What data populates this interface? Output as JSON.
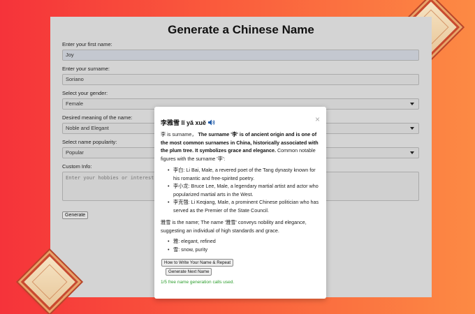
{
  "app": {
    "title": "Generate a Chinese Name",
    "fields": {
      "first_name": {
        "label": "Enter your first name:",
        "value": "Joy"
      },
      "surname": {
        "label": "Enter your surname:",
        "value": "Soriano"
      },
      "gender": {
        "label": "Select your gender:",
        "value": "Female"
      },
      "meaning": {
        "label": "Desired meaning of the name:",
        "value": "Noble and Elegant"
      },
      "popularity": {
        "label": "Select name popularity:",
        "value": "Popular"
      },
      "custom": {
        "label": "Custom Info:",
        "placeholder": "Enter your hobbies or interests"
      }
    },
    "generate_label": "Generate"
  },
  "modal": {
    "name_heading": "李雅雪 lǐ yǎ xuě",
    "close_glyph": "×",
    "surname_prefix": "李 is surname，",
    "surname_bold": "The surname '李' is of ancient origin and is one of the most common surnames in China, historically associated with the plum tree. It symbolizes grace and elegance.",
    "surname_suffix": " Common notable figures with the surname '李':",
    "figures": [
      "李白: Li Bai, Male, a revered poet of the Tang dynasty known for his romantic and free-spirited poetry.",
      "李小龙: Bruce Lee, Male, a legendary martial artist and actor who popularized martial arts in the West.",
      "李克强: Li Keqiang, Male, a prominent Chinese politician who has served as the Premier of the State Council."
    ],
    "name_meaning": "雅雪 is the name; The name '雅雪' conveys nobility and elegance, suggesting an individual of high standards and grace.",
    "chars": [
      "雅: elegant, refined",
      "雪: snow, purity"
    ],
    "write_button": "How to Write Your Name & Repeat",
    "next_button": "Generate Next Name",
    "calls_text": "1/5 free name generation calls used."
  },
  "icons": [
    "speaker-icon",
    "close-icon",
    "chevron-down-icon"
  ]
}
